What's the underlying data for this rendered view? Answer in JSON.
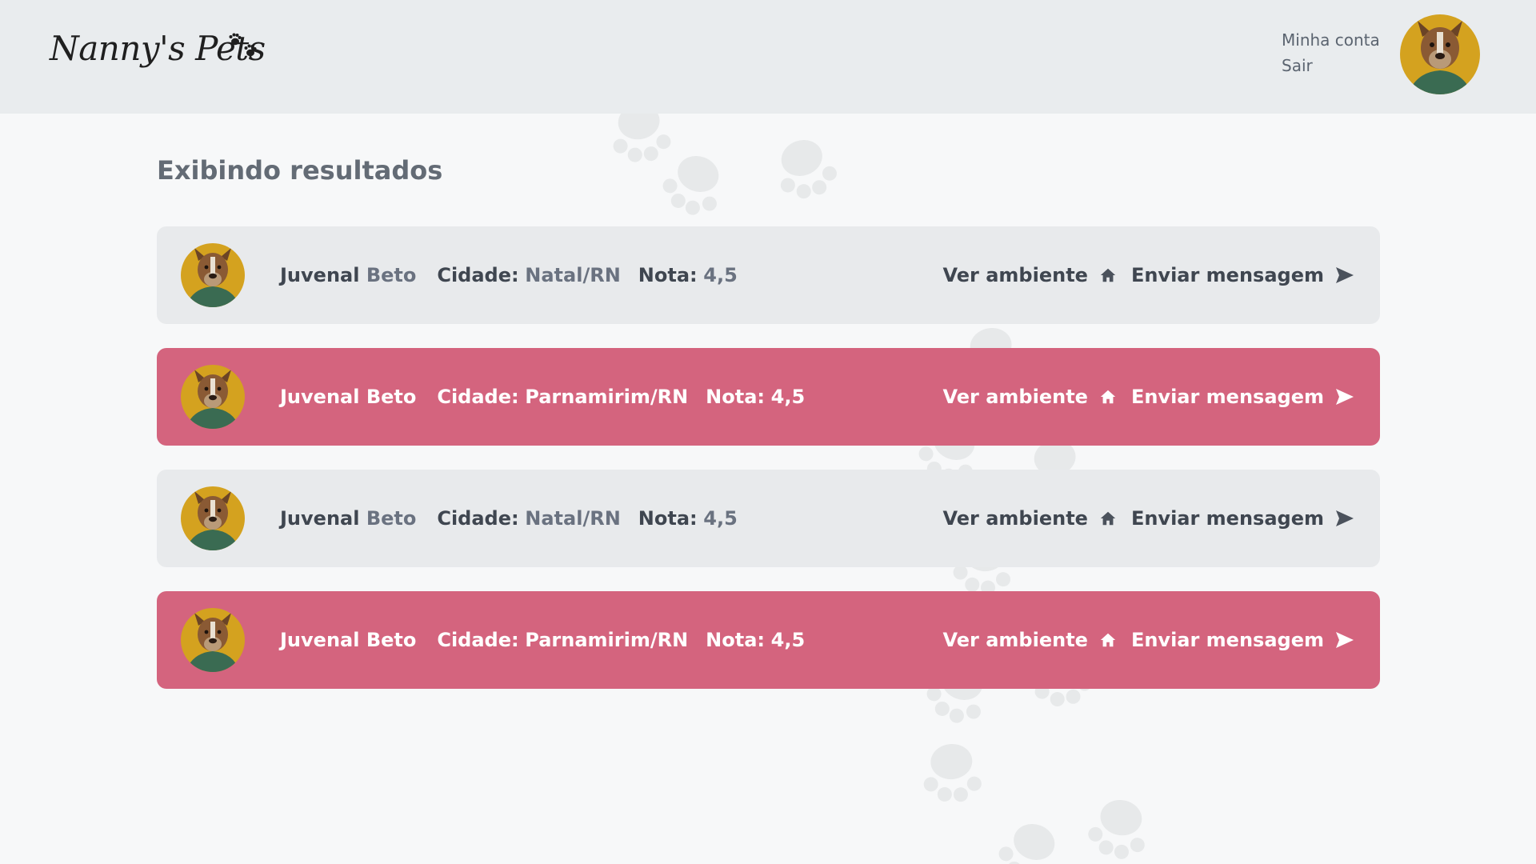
{
  "header": {
    "logo_text": "Nanny's Pets",
    "account_link": "Minha conta",
    "logout_link": "Sair",
    "avatar_icon": "dog-avatar"
  },
  "main": {
    "title": "Exibindo resultados",
    "results": [
      {
        "first_name": "Juvenal",
        "last_name": "Beto",
        "city_label": "Cidade:",
        "city": "Natal/RN",
        "rating_label": "Nota:",
        "rating": "4,5",
        "view_label": "Ver ambiente",
        "message_label": "Enviar mensagem",
        "highlight": false
      },
      {
        "first_name": "Juvenal",
        "last_name": "Beto",
        "city_label": "Cidade:",
        "city": "Parnamirim/RN",
        "rating_label": "Nota:",
        "rating": "4,5",
        "view_label": "Ver ambiente",
        "message_label": "Enviar mensagem",
        "highlight": true
      },
      {
        "first_name": "Juvenal",
        "last_name": "Beto",
        "city_label": "Cidade:",
        "city": "Natal/RN",
        "rating_label": "Nota:",
        "rating": "4,5",
        "view_label": "Ver ambiente",
        "message_label": "Enviar mensagem",
        "highlight": false
      },
      {
        "first_name": "Juvenal",
        "last_name": "Beto",
        "city_label": "Cidade:",
        "city": "Parnamirim/RN",
        "rating_label": "Nota:",
        "rating": "4,5",
        "view_label": "Ver ambiente",
        "message_label": "Enviar mensagem",
        "highlight": true
      }
    ]
  },
  "colors": {
    "header_bg": "#e9ecee",
    "page_bg": "#f7f8f9",
    "card_bg": "#e8eaec",
    "card_highlight_bg": "#d4647e",
    "text_dark": "#3f4650",
    "text_muted": "#6a7280"
  },
  "icons": [
    "paw-icon",
    "home-icon",
    "send-icon",
    "dog-avatar"
  ]
}
